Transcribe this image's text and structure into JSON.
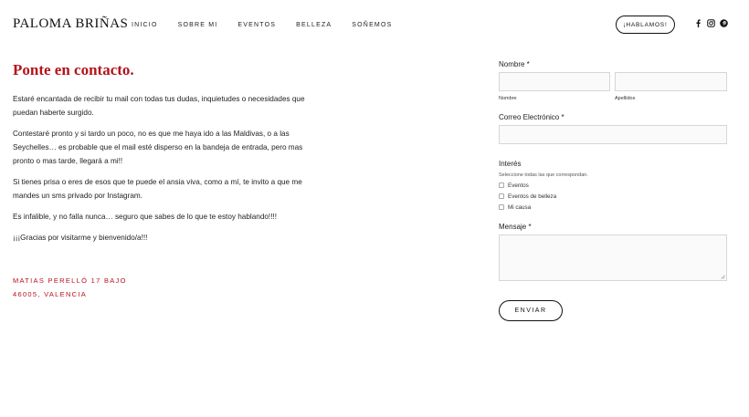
{
  "header": {
    "brand": "PALOMA BRIÑAS",
    "nav": [
      "INICIO",
      "SOBRE MI",
      "EVENTOS",
      "Belleza",
      "SOÑEMOS"
    ],
    "cta_label": "¡HABLAMOS!",
    "social_icons": [
      "facebook-icon",
      "instagram-icon",
      "pinterest-icon"
    ]
  },
  "contact": {
    "title": "Ponte en contacto.",
    "paragraphs": [
      "Estaré encantada de recibir tu mail con todas tus dudas, inquietudes o necesidades que puedan haberte surgido.",
      "Contestaré pronto y si tardo un poco,  no es que me haya  ido a las Maldivas, o a las Seychelles… es probable que el mail esté disperso en la bandeja de entrada, pero mas pronto o mas tarde, llegará a mi!!",
      "Si tienes prisa o eres de esos que te puede el ansia viva, como a mí, te invito a que me mandes un sms privado por Instagram.",
      "Es infalible, y no falla nunca… seguro que sabes de lo que te estoy hablando!!!!",
      "¡¡¡Gracias por visitarme y bienvenido/a!!!"
    ],
    "address_line1": "MATIAS PERELLÓ 17 BAJO",
    "address_line2": "46005, VALENCIA"
  },
  "form": {
    "name_label": "Nombre *",
    "first_sub": "Nombre",
    "last_sub": "Apellidos",
    "email_label": "Correo Electrónico *",
    "interest_label": "Interés",
    "interest_helper": "Seleccione todas las que correspondan.",
    "options": [
      "Eventos",
      "Eventos de belleza",
      "Mi causa"
    ],
    "message_label": "Mensaje *",
    "submit_label": "ENVIAR"
  },
  "colors": {
    "accent": "#b5121b",
    "text": "#1a1a1a",
    "field_bg": "#fafafa",
    "field_border": "#d6d6d6"
  }
}
